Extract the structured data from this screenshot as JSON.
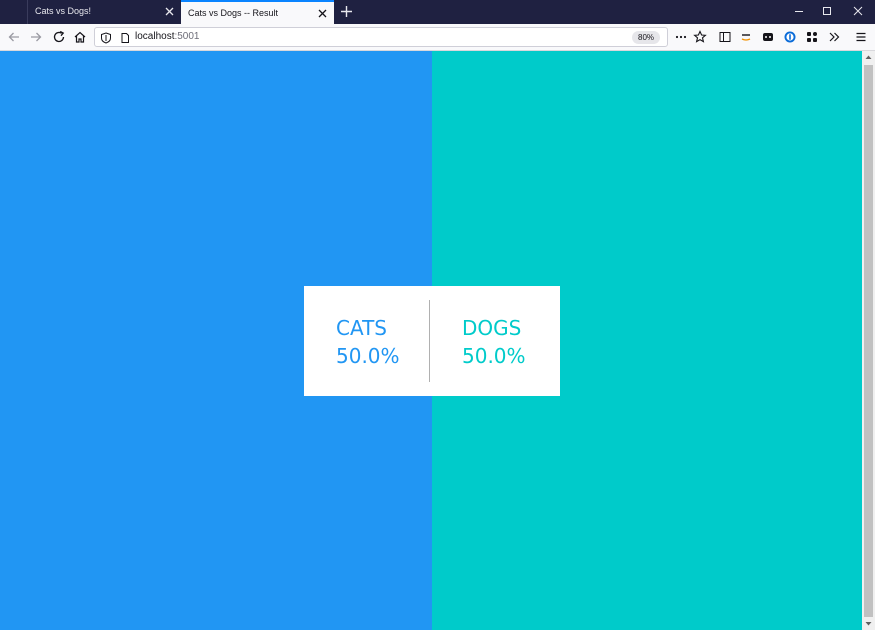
{
  "tabs": [
    {
      "title": "Cats vs Dogs!",
      "active": false
    },
    {
      "title": "Cats vs Dogs -- Result",
      "active": true
    }
  ],
  "address_bar": {
    "host": "localhost",
    "port": ":5001"
  },
  "zoom": "80%",
  "results": {
    "cats": {
      "label": "CATS",
      "percent": "50.0%"
    },
    "dogs": {
      "label": "DOGS",
      "percent": "50.0%"
    }
  },
  "colors": {
    "cats": "#2196f3",
    "dogs": "#00cbca",
    "accent": "#0a84ff"
  },
  "icons": {
    "back": "back-arrow-icon",
    "forward": "forward-arrow-icon",
    "reload": "reload-icon",
    "home": "home-icon",
    "tracking": "shield-icon",
    "page": "page-icon",
    "more": "more-icon",
    "bookmark": "star-icon",
    "sidebar": "sidebar-icon",
    "amazon": "amazon-icon",
    "extension": "extension-icon",
    "password": "password-manager-icon",
    "apps": "apps-grid-icon",
    "overflow": "chevron-double-right-icon",
    "menu": "hamburger-menu-icon"
  }
}
